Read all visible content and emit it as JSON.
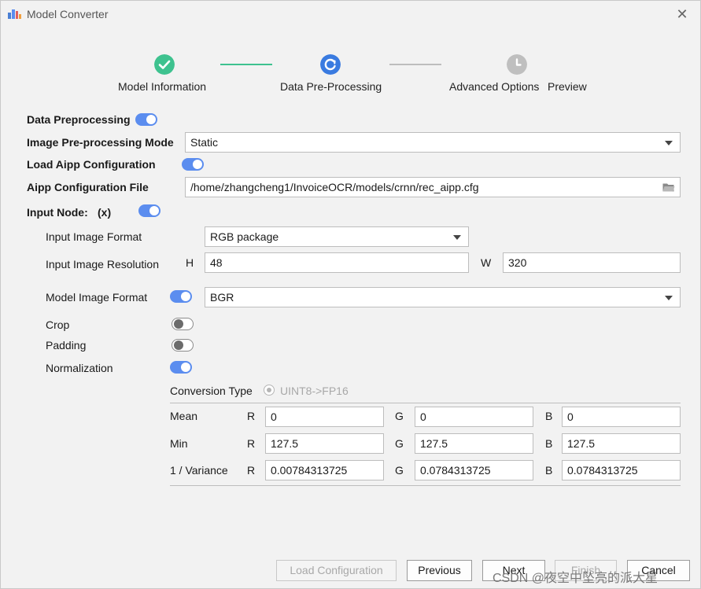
{
  "window": {
    "title": "Model Converter"
  },
  "steps": [
    {
      "label": "Model Information",
      "state": "done"
    },
    {
      "label": "Data Pre-Processing",
      "state": "current"
    },
    {
      "label": "Advanced Options",
      "state": "pending"
    },
    {
      "label": "Preview",
      "state": "pending"
    }
  ],
  "form": {
    "data_preprocessing": {
      "label": "Data Preprocessing",
      "on": true
    },
    "mode": {
      "label": "Image Pre-processing Mode",
      "value": "Static"
    },
    "load_aipp": {
      "label": "Load Aipp Configuration",
      "on": true
    },
    "aipp_file": {
      "label": "Aipp Configuration File",
      "value": "/home/zhangcheng1/InvoiceOCR/models/crnn/rec_aipp.cfg"
    },
    "input_node": {
      "label": "Input Node:",
      "name": "(x)",
      "on": true
    },
    "input_image_format": {
      "label": "Input Image Format",
      "value": "RGB package"
    },
    "input_resolution": {
      "label": "Input Image Resolution",
      "h_label": "H",
      "h_value": "48",
      "w_label": "W",
      "w_value": "320"
    },
    "model_image_format": {
      "label": "Model Image Format",
      "on": true,
      "value": "BGR"
    },
    "crop": {
      "label": "Crop",
      "on": false
    },
    "padding": {
      "label": "Padding",
      "on": false
    },
    "normalization": {
      "label": "Normalization",
      "on": true
    },
    "conversion_type": {
      "label": "Conversion Type",
      "option": "UINT8->FP16"
    },
    "channels": {
      "r": "R",
      "g": "G",
      "b": "B"
    },
    "rows": [
      {
        "label": "Mean",
        "r": "0",
        "g": "0",
        "b": "0"
      },
      {
        "label": "Min",
        "r": "127.5",
        "g": "127.5",
        "b": "127.5"
      },
      {
        "label": "1 / Variance",
        "r": "0.00784313725",
        "g": "0.0784313725",
        "b": "0.0784313725"
      }
    ]
  },
  "buttons": {
    "load_config": "Load Configuration",
    "previous": "Previous",
    "next": "Next",
    "finish": "Finish",
    "cancel": "Cancel"
  },
  "watermark": "CSDN @夜空中坠亮的派大星",
  "colors": {
    "accent": "#5b8def",
    "done": "#3ec28f",
    "pending": "#bfbfbf"
  }
}
